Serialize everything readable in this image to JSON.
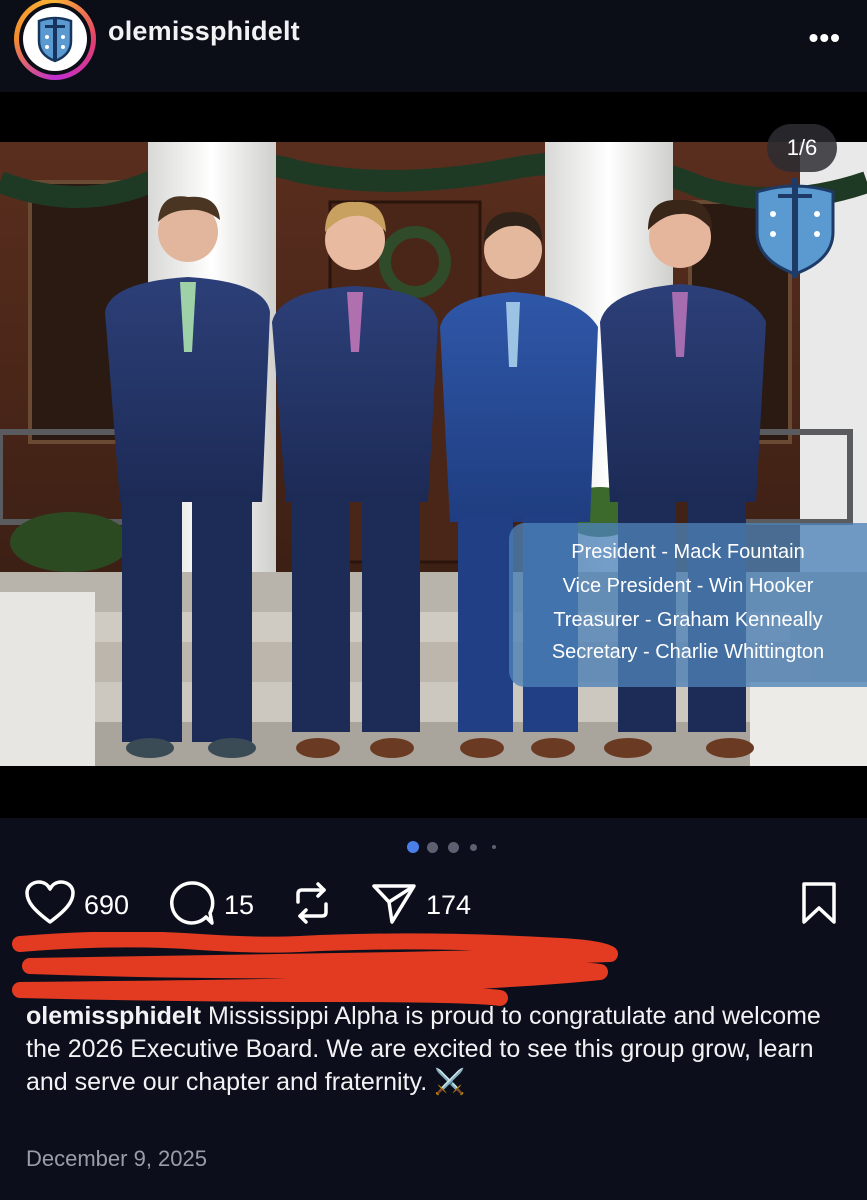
{
  "header": {
    "username": "olemissphidelt",
    "more_label": "•••"
  },
  "post": {
    "counter": "1/6",
    "board_members": [
      "President - Mack Fountain",
      "Vice President - Win Hooker",
      "Treasurer - Graham Kenneally",
      "Secretary - Charlie Whittington"
    ],
    "carousel": {
      "total": 6,
      "current": 1
    }
  },
  "actions": {
    "likes": "690",
    "comments": "15",
    "shares": "174"
  },
  "caption": {
    "username": "olemissphidelt",
    "text": " Mississippi Alpha is proud to congratulate and welcome the 2026 Executive Board. We are excited to see this group grow, learn and serve our chapter and fraternity. ⚔️"
  },
  "date": "December 9, 2025",
  "colors": {
    "background": "#0a0c14",
    "accent_dot": "#4a7fe8",
    "scribble": "#e23b22",
    "infobox": "#4d81b7"
  }
}
